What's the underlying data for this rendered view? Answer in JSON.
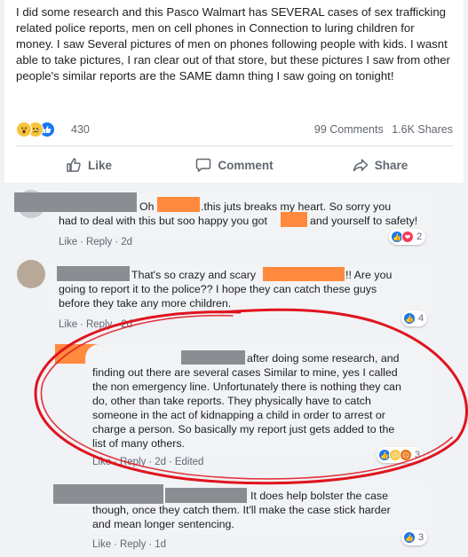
{
  "post": {
    "text": "I did some research and this Pasco Walmart has SEVERAL cases of sex trafficking related police reports, men on cell phones in Connection to luring children for money. I saw Several pictures of men on phones following people with kids. I wasnt able to take pictures, I ran clear out of that store, but these pictures I saw from other people's similar reports are the SAME damn thing I saw going on tonight!",
    "reaction_count": "430",
    "comments_count": "99 Comments",
    "shares_count": "1.6K Shares"
  },
  "actions": {
    "like": "Like",
    "comment": "Comment",
    "share": "Share"
  },
  "comments": [
    {
      "line1_a": "Oh",
      "line1_b": ".this juts breaks my heart. So sorry you",
      "line2_a": "had to deal with this but soo happy you got",
      "line2_b": "and yourself to safety!",
      "like": "Like",
      "reply": "Reply",
      "time": "2d",
      "reaction_count": "2"
    },
    {
      "line1_a": "That's so crazy and scary",
      "line1_b": "!! Are you",
      "line2": "going to report it to the police?? I hope they can catch these guys",
      "line3": "before they take any more children.",
      "like": "Like",
      "reply": "Reply",
      "time": "2d",
      "reaction_count": "4"
    },
    {
      "line1": "after doing some research, and",
      "line2": "finding out there are several cases Similar to mine, yes I called",
      "line3": "the non emergency line. Unfortunately there is nothing they can",
      "line4": "do, other than take reports. They physically have to catch",
      "line5": "someone in the act of kidnapping a child in order to arrest or",
      "line6": "charge a person. So basically my report just gets added to the",
      "line7": "list of many others.",
      "like": "Like",
      "reply": "Reply",
      "time": "2d",
      "edited": "Edited",
      "reaction_count": "3"
    },
    {
      "line1": "It does help bolster the case",
      "line2": "though, once they catch them. It'll make the case stick harder",
      "line3": "and mean longer sentencing.",
      "like": "Like",
      "reply": "Reply",
      "time": "1d",
      "reaction_count": "3"
    }
  ],
  "colors": {
    "accent": "#1877f2",
    "redaction_orange": "#ff8a3d",
    "redaction_gray": "#8a8d91",
    "annotation_red": "#e0141e"
  }
}
